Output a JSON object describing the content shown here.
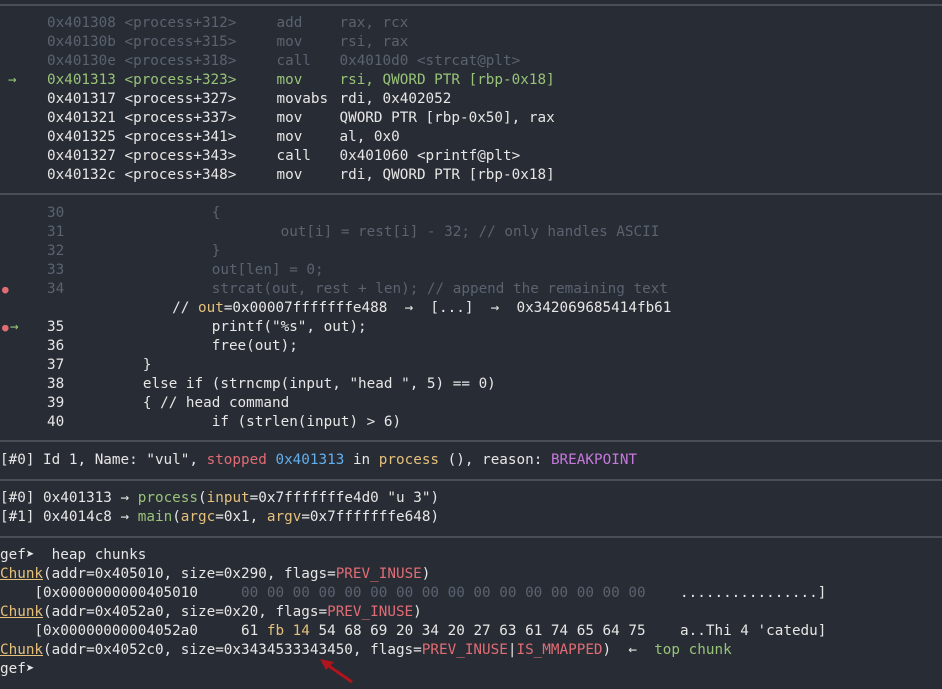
{
  "disasm": [
    {
      "addr": "0x401308",
      "sym": "<process+312>",
      "op": "add",
      "args": "rax, rcx",
      "state": "past"
    },
    {
      "addr": "0x40130b",
      "sym": "<process+315>",
      "op": "mov",
      "args": "rsi, rax",
      "state": "past"
    },
    {
      "addr": "0x40130e",
      "sym": "<process+318>",
      "op": "call",
      "args": "0x4010d0 <strcat@plt>",
      "state": "past"
    },
    {
      "addr": "0x401313",
      "sym": "<process+323>",
      "op": "mov",
      "args": "rsi, QWORD PTR [rbp-0x18]",
      "state": "current",
      "marker": "→"
    },
    {
      "addr": "0x401317",
      "sym": "<process+327>",
      "op": "movabs",
      "args": "rdi, 0x402052",
      "state": "next"
    },
    {
      "addr": "0x401321",
      "sym": "<process+337>",
      "op": "mov",
      "args": "QWORD PTR [rbp-0x50], rax",
      "state": "next"
    },
    {
      "addr": "0x401325",
      "sym": "<process+341>",
      "op": "mov",
      "args": "al, 0x0",
      "state": "next"
    },
    {
      "addr": "0x401327",
      "sym": "<process+343>",
      "op": "call",
      "args": "0x401060 <printf@plt>",
      "state": "next"
    },
    {
      "addr": "0x40132c",
      "sym": "<process+348>",
      "op": "mov",
      "args": "rdi, QWORD PTR [rbp-0x18]",
      "state": "next"
    }
  ],
  "source": [
    {
      "num": "30",
      "code": "{",
      "indent": "                ",
      "state": "past"
    },
    {
      "num": "31",
      "code": "out[i] = rest[i] - 32; // only handles ASCII",
      "indent": "                        ",
      "state": "past"
    },
    {
      "num": "32",
      "code": "}",
      "indent": "                ",
      "state": "past"
    },
    {
      "num": "33",
      "code": "out[len] = 0;",
      "indent": "                ",
      "state": "past"
    },
    {
      "num": "34",
      "code": "strcat(out, rest + len); // append the remaining text",
      "indent": "                ",
      "state": "past",
      "bp": "●"
    },
    {
      "num": "35",
      "code": "printf(\"%s\", out);",
      "indent": "                ",
      "state": "next",
      "bp": "●",
      "marker": "→"
    },
    {
      "num": "36",
      "code": "free(out);",
      "indent": "                ",
      "state": "next"
    },
    {
      "num": "37",
      "code": "}",
      "indent": "        ",
      "state": "next"
    },
    {
      "num": "38",
      "code": "else if (strncmp(input, \"head \", 5) == 0)",
      "indent": "        ",
      "state": "next"
    },
    {
      "num": "39",
      "code": "{ // head command",
      "indent": "        ",
      "state": "next"
    },
    {
      "num": "40",
      "code": "if (strlen(input) > 6)",
      "indent": "                ",
      "state": "next"
    }
  ],
  "hint": {
    "prefix": "// ",
    "var": "out",
    "value": "=0x00007fffffffe488  →  [...]  →  0x342069685414fb61"
  },
  "thread": {
    "idx": "[#0]",
    "id": "Id 1, Name: \"vul\", ",
    "stopped": "stopped",
    "addr": "0x401313",
    "in": " in ",
    "func": "process",
    "rest": " (), reason: ",
    "reason": "BREAKPOINT"
  },
  "trace": [
    {
      "idx": "[#0]",
      "addr": "0x401313",
      "func": "process",
      "open": "(",
      "arg1": "input",
      "val1": "=0x7fffffffe4d0 \"u 3\"",
      "close": ")"
    },
    {
      "idx": "[#1]",
      "addr": "0x4014c8",
      "func": "main",
      "open": "(",
      "arg1": "argc",
      "val1": "=0x1, ",
      "arg2": "argv",
      "val2": "=0x7fffffffe648",
      "close": ")"
    }
  ],
  "prompt": "gef➤",
  "command": "heap chunks",
  "chunks": [
    {
      "kw": "Chunk",
      "body": "(addr=0x405010, size=0x290, flags=",
      "flags": "PREV_INUSE",
      "tail": ")",
      "dump_addr": "[0x0000000000405010",
      "dump_hex": "00 00 00 00 00 00 00 00 00 00 00 00 00 00 00 00",
      "dump_ascii": "................]"
    },
    {
      "kw": "Chunk",
      "body": "(addr=0x4052a0, size=0x20, flags=",
      "flags": "PREV_INUSE",
      "tail": ")",
      "dump_addr": "[0x00000000004052a0",
      "dump_hex_a": "61 ",
      "dump_hex_b": "fb 14",
      "dump_hex_c": " 54 68 69 20 34 20 27 63 61 74 65 64 75",
      "dump_ascii": "a..Thi 4 'catedu]"
    },
    {
      "kw": "Chunk",
      "body": "(addr=0x4052c0, size=0x3434533343450, flags=",
      "flags": "PREV_INUSE",
      "pipe": "|",
      "flags2": "IS_MMAPPED",
      "tail": ")  ←  ",
      "top": "top chunk"
    }
  ]
}
